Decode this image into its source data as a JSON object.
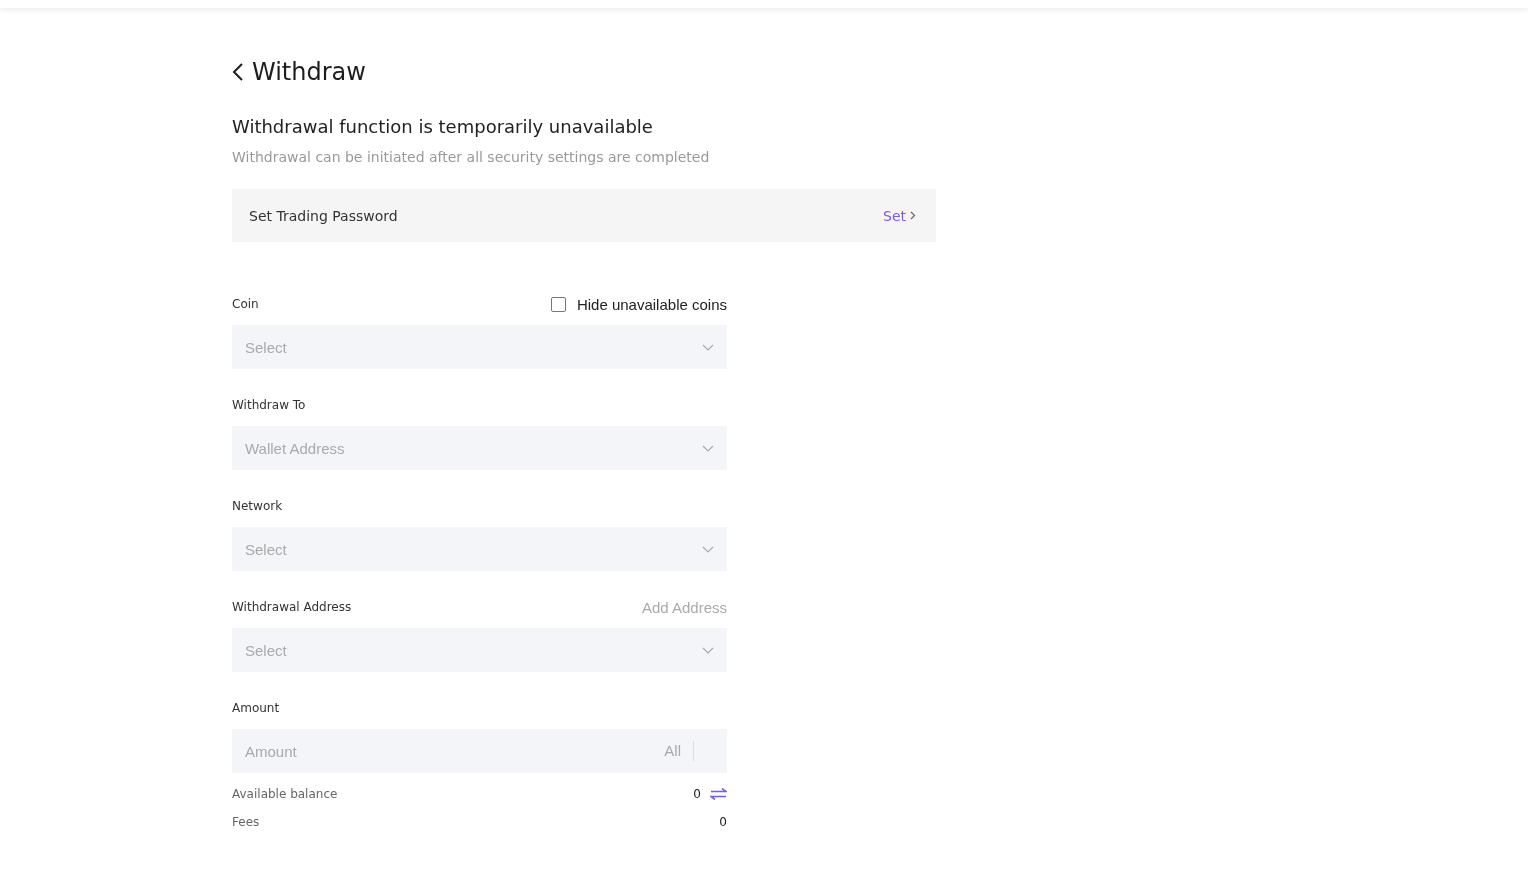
{
  "page": {
    "title": "Withdraw"
  },
  "notice": {
    "heading": "Withdrawal function is temporarily unavailable",
    "description": "Withdrawal can be initiated after all security settings are completed",
    "task": {
      "label": "Set Trading Password",
      "action": "Set"
    }
  },
  "fields": [
    {
      "label": "Coin",
      "kind": "select",
      "placeholder": "Select",
      "extra": {
        "kind": "checkbox",
        "label": "Hide unavailable coins",
        "checked": false
      }
    },
    {
      "label": "Withdraw To",
      "kind": "select",
      "placeholder": "Wallet Address"
    },
    {
      "label": "Network",
      "kind": "select",
      "placeholder": "Select"
    },
    {
      "label": "Withdrawal Address",
      "kind": "select",
      "placeholder": "Select",
      "extra": {
        "kind": "link",
        "label": "Add Address"
      }
    },
    {
      "label": "Amount",
      "kind": "input",
      "placeholder": "Amount",
      "suffix": "All"
    }
  ],
  "summary": [
    {
      "label": "Available balance",
      "value": "0",
      "kind": "transfer"
    },
    {
      "label": "Fees",
      "value": "0",
      "kind": "plain"
    }
  ]
}
